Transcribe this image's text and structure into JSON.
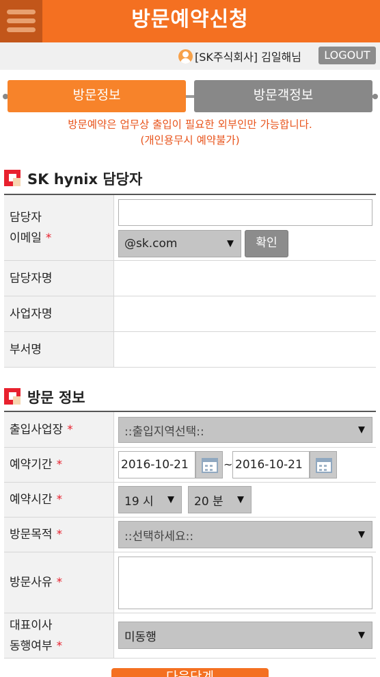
{
  "header": {
    "title": "방문예약신청",
    "menu_icon": "hamburger-icon"
  },
  "userbar": {
    "user_text": "[SK주식회사] 김일해님",
    "logout_label": "LOGOUT",
    "user_icon": "user-icon"
  },
  "tabs": [
    {
      "label": "방문정보",
      "active": true
    },
    {
      "label": "방문객정보",
      "active": false
    }
  ],
  "notice": {
    "line1": "방문예약은 업무상 출입이 필요한 외부인만 가능합니다.",
    "line2": "(개인용무시 예약불가)"
  },
  "section1": {
    "title": "SK hynix 담당자",
    "email_label_line1": "담당자",
    "email_label_line2": "이메일",
    "required_mark": "*",
    "email_value": "",
    "domain_selected": "@sk.com",
    "confirm_label": "확인",
    "manager_name_label": "담당자명",
    "manager_name_value": "",
    "business_label": "사업자명",
    "business_value": "",
    "dept_label": "부서명",
    "dept_value": ""
  },
  "section2": {
    "title": "방문 정보",
    "site_label": "출입사업장",
    "site_selected": "::출입지역선택::",
    "period_label": "예약기간",
    "date_from": "2016-10-21",
    "date_sep": "~",
    "date_to": "2016-10-21",
    "time_label": "예약시간",
    "hour_selected": "19 시",
    "minute_selected": "20 분",
    "purpose_label": "방문목적",
    "purpose_selected": "::선택하세요::",
    "reason_label": "방문사유",
    "reason_value": "",
    "ceo_label_line1": "대표이사",
    "ceo_label_line2": "동행여부",
    "ceo_selected": "미동행"
  },
  "next_label": "다음단계",
  "colors": {
    "brand": "#f47021",
    "required": "#e8212e",
    "notice": "#e8541c"
  }
}
